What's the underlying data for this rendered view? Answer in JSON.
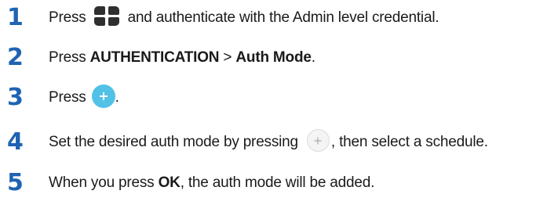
{
  "steps": [
    {
      "number": "1",
      "before_icon": "Press",
      "icon": "grid-menu-icon",
      "after_icon": "and authenticate with the Admin level credential."
    },
    {
      "number": "2",
      "prefix": "Press ",
      "bold1": "AUTHENTICATION",
      "separator": " > ",
      "bold2": "Auth Mode",
      "suffix": "."
    },
    {
      "number": "3",
      "before_icon": "Press",
      "icon": "add-circle-icon",
      "icon_color": "#51c2e6",
      "after_icon": "."
    },
    {
      "number": "4",
      "before_icon": "Set the desired auth mode by pressing",
      "icon": "add-circle-outline-icon",
      "after_icon": ", then select a schedule."
    },
    {
      "number": "5",
      "prefix": "When you press ",
      "bold1": "OK",
      "suffix": ", the auth mode will be added."
    }
  ],
  "colors": {
    "step_number": "#1f63b3",
    "text": "#1a1a1a"
  }
}
